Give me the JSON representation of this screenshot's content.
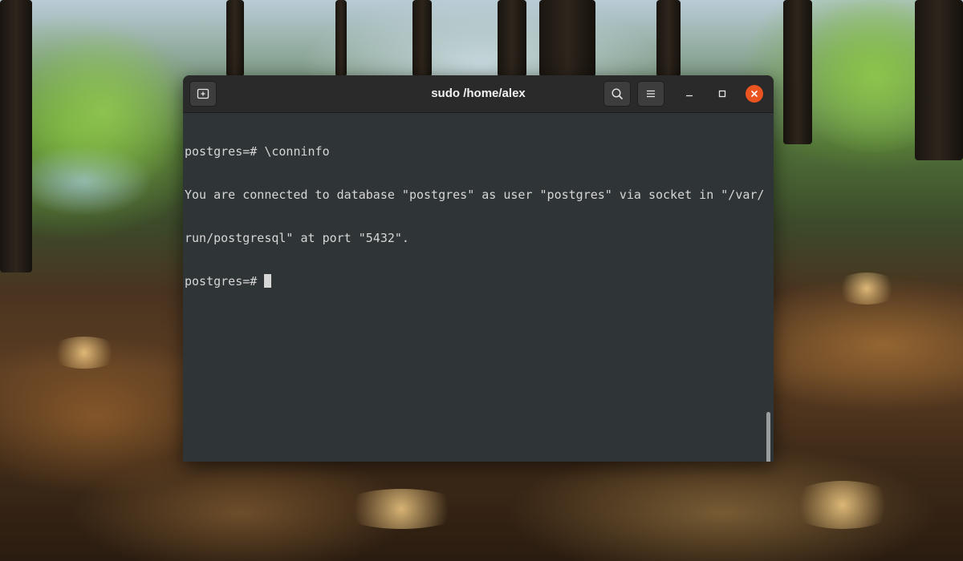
{
  "window": {
    "title": "sudo /home/alex"
  },
  "icons": {
    "new_tab": "new-tab-icon",
    "search": "search-icon",
    "menu": "hamburger-menu-icon",
    "minimize": "minimize-icon",
    "maximize": "maximize-icon",
    "close": "close-icon"
  },
  "terminal": {
    "lines": [
      "postgres=# \\conninfo",
      "You are connected to database \"postgres\" as user \"postgres\" via socket in \"/var/",
      "run/postgresql\" at port \"5432\".",
      "postgres=# "
    ]
  },
  "colors": {
    "close_button": "#e95420",
    "terminal_background": "#2f3436",
    "terminal_foreground": "#d6d6d6",
    "titlebar": "#2a2a2a"
  }
}
